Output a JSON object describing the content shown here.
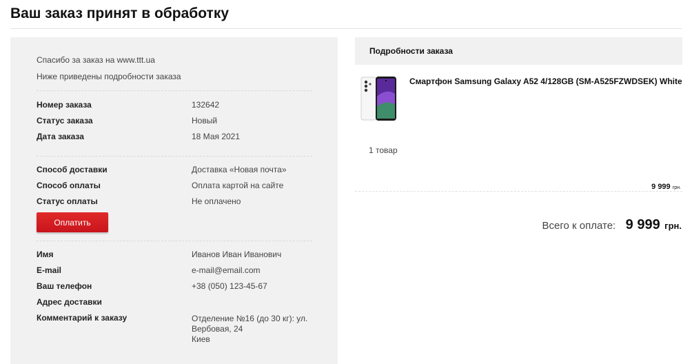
{
  "page": {
    "title": "Ваш заказ принят в обработку"
  },
  "intro": {
    "thanks": "Спасибо за заказ на www.ttt.ua",
    "details_note": "Ниже приведены подробности заказа"
  },
  "order": {
    "number_label": "Номер заказа",
    "number": "132642",
    "status_label": "Статус заказа",
    "status": "Новый",
    "date_label": "Дата заказа",
    "date": "18 Мая 2021"
  },
  "delivery": {
    "method_label": "Способ доставки",
    "method": "Доставка «Новая почта»",
    "payment_label": "Способ оплаты",
    "payment": "Оплата картой на сайте",
    "payment_status_label": "Статус оплаты",
    "payment_status": "Не оплачено",
    "pay_button": "Оплатить"
  },
  "customer": {
    "name_label": "Имя",
    "name": "Иванов Иван Иванович",
    "email_label": "E-mail",
    "email": "e-mail@email.com",
    "phone_label": "Ваш телефон",
    "phone": "+38 (050) 123-45-67",
    "address_label": "Адрес доставки",
    "comment_label": "Комментарий к заказу",
    "comment_lines": [
      "Отделение №16 (до 30 кг): ул.",
      "Вербовая, 24",
      "Киев"
    ]
  },
  "details": {
    "header": "Подробности заказа",
    "product_name": "Смартфон Samsung Galaxy A52 4/128GB (SM-A525FZWDSEK) White",
    "product_image_icon": "smartphone-icon",
    "item_count": "1 товар",
    "item_price": "9 999",
    "item_currency": "грн.",
    "total_label": "Всего к оплате:",
    "total_amount": "9 999",
    "total_currency": "грн."
  },
  "colors": {
    "accent": "#d41c24",
    "panel": "#f1f1f1"
  }
}
